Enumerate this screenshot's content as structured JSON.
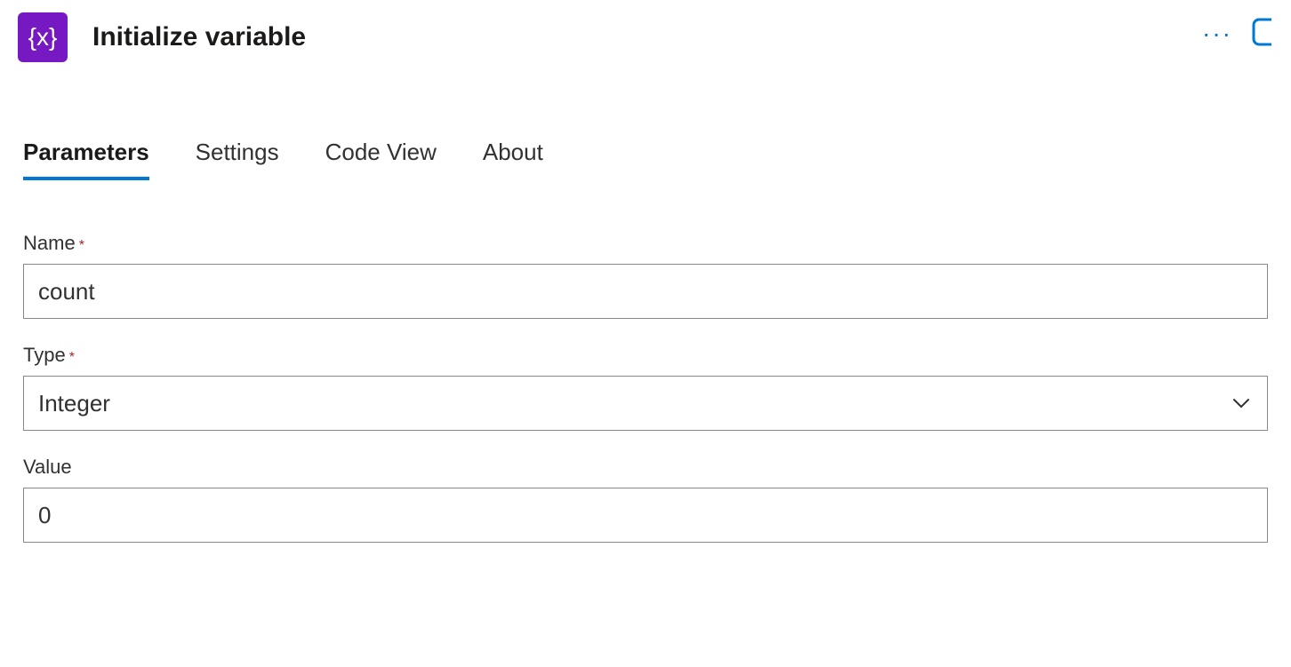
{
  "header": {
    "icon_bg": "#7719c2",
    "icon_glyph": "{x}",
    "title": "Initialize variable"
  },
  "tabs": [
    {
      "label": "Parameters",
      "active": true
    },
    {
      "label": "Settings",
      "active": false
    },
    {
      "label": "Code View",
      "active": false
    },
    {
      "label": "About",
      "active": false
    }
  ],
  "form": {
    "name": {
      "label": "Name",
      "required": true,
      "value": "count"
    },
    "type": {
      "label": "Type",
      "required": true,
      "value": "Integer"
    },
    "value": {
      "label": "Value",
      "required": false,
      "value": "0"
    }
  }
}
